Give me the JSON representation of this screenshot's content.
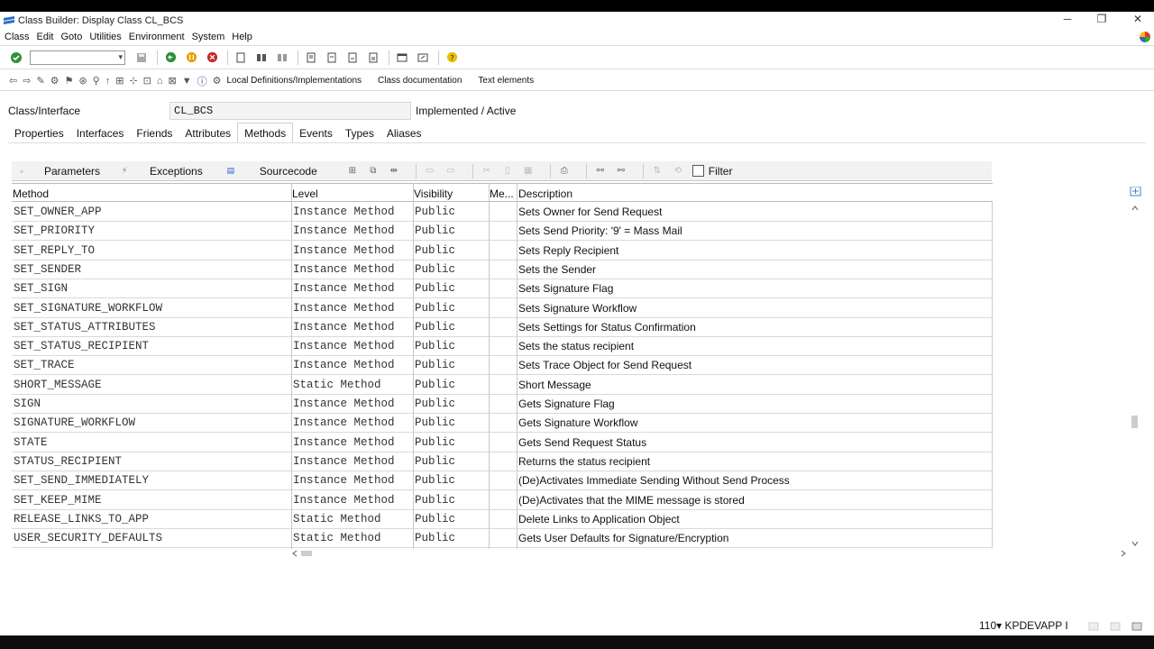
{
  "window": {
    "title": "Class Builder: Display Class CL_BCS",
    "minimize": "─",
    "restore": "❐",
    "close": "✕"
  },
  "menu": [
    "Class",
    "Edit",
    "Goto",
    "Utilities",
    "Environment",
    "System",
    "Help"
  ],
  "toolbar2": {
    "local_definitions": "Local Definitions/Implementations",
    "class_documentation": "Class documentation",
    "text_elements": "Text elements"
  },
  "header": {
    "class_label": "Class/Interface",
    "class_value": "CL_BCS",
    "status": "Implemented / Active"
  },
  "tabs": [
    "Properties",
    "Interfaces",
    "Friends",
    "Attributes",
    "Methods",
    "Events",
    "Types",
    "Aliases"
  ],
  "active_tab": "Methods",
  "subtoolbar": {
    "parameters": "Parameters",
    "exceptions": "Exceptions",
    "sourcecode": "Sourcecode",
    "filter": "Filter"
  },
  "grid": {
    "columns": [
      "Method",
      "Level",
      "Visibility",
      "Me...",
      "Description"
    ],
    "rows": [
      {
        "method": "SET_OWNER_APP",
        "level": "Instance Method",
        "visibility": "Public",
        "description": "Sets Owner for Send Request"
      },
      {
        "method": "SET_PRIORITY",
        "level": "Instance Method",
        "visibility": "Public",
        "description": "Sets Send Priority: '9' = Mass Mail"
      },
      {
        "method": "SET_REPLY_TO",
        "level": "Instance Method",
        "visibility": "Public",
        "description": "Sets Reply Recipient"
      },
      {
        "method": "SET_SENDER",
        "level": "Instance Method",
        "visibility": "Public",
        "description": "Sets the Sender"
      },
      {
        "method": "SET_SIGN",
        "level": "Instance Method",
        "visibility": "Public",
        "description": "Sets Signature Flag"
      },
      {
        "method": "SET_SIGNATURE_WORKFLOW",
        "level": "Instance Method",
        "visibility": "Public",
        "description": "Sets Signature Workflow"
      },
      {
        "method": "SET_STATUS_ATTRIBUTES",
        "level": "Instance Method",
        "visibility": "Public",
        "description": "Sets Settings for Status Confirmation"
      },
      {
        "method": "SET_STATUS_RECIPIENT",
        "level": "Instance Method",
        "visibility": "Public",
        "description": "Sets the status recipient"
      },
      {
        "method": "SET_TRACE",
        "level": "Instance Method",
        "visibility": "Public",
        "description": "Sets Trace Object for Send Request"
      },
      {
        "method": "SHORT_MESSAGE",
        "level": "Static Method",
        "visibility": "Public",
        "description": "Short Message"
      },
      {
        "method": "SIGN",
        "level": "Instance Method",
        "visibility": "Public",
        "description": "Gets Signature Flag"
      },
      {
        "method": "SIGNATURE_WORKFLOW",
        "level": "Instance Method",
        "visibility": "Public",
        "description": "Gets Signature Workflow"
      },
      {
        "method": "STATE",
        "level": "Instance Method",
        "visibility": "Public",
        "description": "Gets Send Request Status"
      },
      {
        "method": "STATUS_RECIPIENT",
        "level": "Instance Method",
        "visibility": "Public",
        "description": "Returns the status recipient"
      },
      {
        "method": "SET_SEND_IMMEDIATELY",
        "level": "Instance Method",
        "visibility": "Public",
        "description": "(De)Activates Immediate Sending Without Send Process"
      },
      {
        "method": "SET_KEEP_MIME",
        "level": "Instance Method",
        "visibility": "Public",
        "description": "(De)Activates that the MIME message is stored"
      },
      {
        "method": "RELEASE_LINKS_TO_APP",
        "level": "Static Method",
        "visibility": "Public",
        "description": "Delete Links to Application Object"
      },
      {
        "method": "USER_SECURITY_DEFAULTS",
        "level": "Static Method",
        "visibility": "Public",
        "description": "Gets User Defaults for Signature/Encryption"
      }
    ]
  },
  "status_bar": {
    "system": "110▾ KPDEVAPP I"
  },
  "colors": {
    "accent": "#1f5fa8",
    "header_bg": "#f2f2f2"
  }
}
